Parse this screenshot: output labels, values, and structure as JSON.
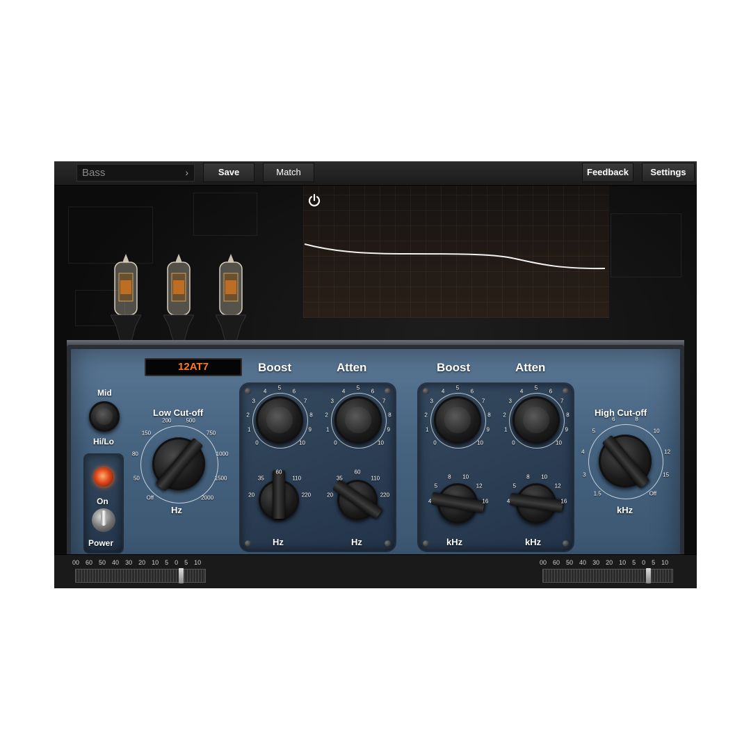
{
  "toolbar": {
    "preset_name": "Bass",
    "preset_chevron": "›",
    "save_label": "Save",
    "match_label": "Match",
    "feedback_label": "Feedback",
    "settings_label": "Settings"
  },
  "tube_type": "12AT7",
  "switch_mid_label": "Mid",
  "switch_hilo_label": "Hi/Lo",
  "on_label": "On",
  "power_label": "Power",
  "low_cutoff": {
    "title": "Low Cut-off",
    "unit": "Hz",
    "ticks": [
      "Off",
      "50",
      "80",
      "150",
      "200",
      "500",
      "750",
      "1000",
      "1500",
      "2000"
    ]
  },
  "low_section": {
    "boost_label": "Boost",
    "atten_label": "Atten",
    "level_ticks": [
      "0",
      "1",
      "2",
      "3",
      "4",
      "5",
      "6",
      "7",
      "8",
      "9",
      "10"
    ],
    "freq_ticks": [
      "20",
      "35",
      "60",
      "110",
      "220"
    ],
    "unit": "Hz"
  },
  "high_section": {
    "boost_label": "Boost",
    "atten_label": "Atten",
    "level_ticks": [
      "0",
      "1",
      "2",
      "3",
      "4",
      "5",
      "6",
      "7",
      "8",
      "9",
      "10"
    ],
    "freq_ticks": [
      "4",
      "5",
      "8",
      "10",
      "12",
      "16"
    ],
    "unit": "kHz"
  },
  "high_cutoff": {
    "title": "High Cut-off",
    "unit": "kHz",
    "ticks": [
      "1.5",
      "3",
      "4",
      "5",
      "6",
      "8",
      "10",
      "12",
      "15",
      "Off"
    ]
  },
  "meter_scale": [
    "00",
    "60",
    "50",
    "40",
    "30",
    "20",
    "10",
    "5",
    "0",
    "5",
    "10"
  ],
  "colors": {
    "display_text": "#ff7a1a",
    "plate_blue": "#4a6784",
    "curve": "#ffffff"
  }
}
